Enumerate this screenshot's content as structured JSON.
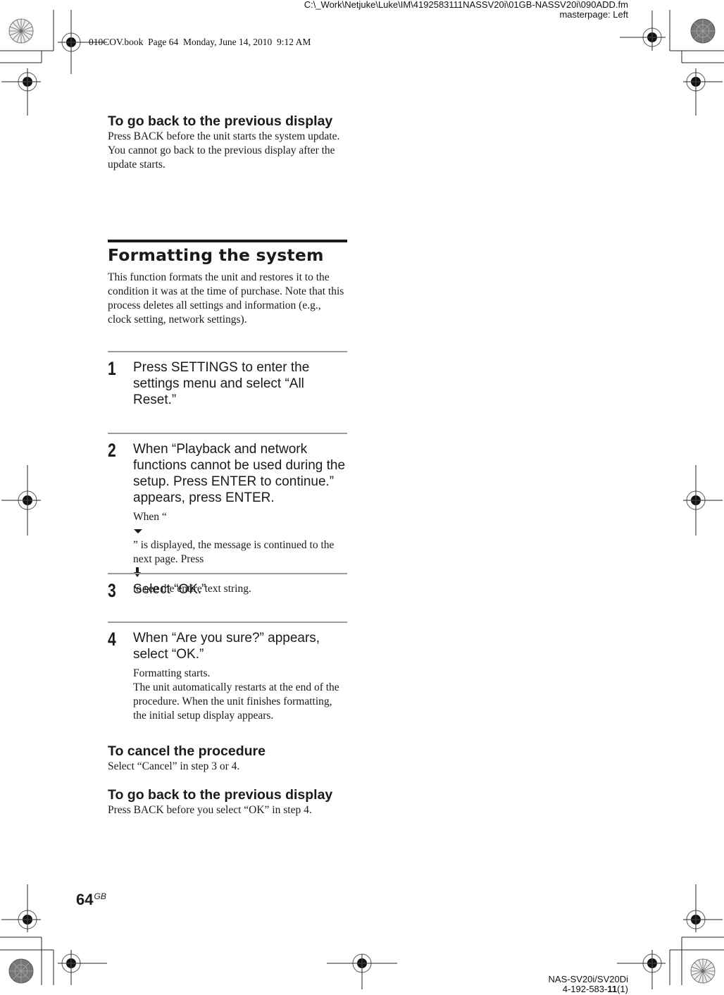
{
  "header": {
    "file_path": "C:\\_Work\\Netjuke\\Luke\\IM\\4192583111NASSV20i\\01GB-NASSV20i\\090ADD.fm",
    "masterpage": "masterpage: Left",
    "book_line": "010COV.book  Page 64  Monday, June 14, 2010  9:12 AM"
  },
  "intro": {
    "heading": "To go back to the previous display",
    "lines": [
      "Press BACK before the unit starts the system update.",
      "You cannot go back to the previous display after the update starts."
    ]
  },
  "section": {
    "title": "Formatting the system",
    "description": "This function formats the unit and restores it to the condition it was at the time of purchase. Note that this process deletes all settings and information (e.g., clock setting, network settings).",
    "steps": [
      {
        "number": "1",
        "text": "Press SETTINGS to enter the settings menu and select “All Reset.”"
      },
      {
        "number": "2",
        "text": "When “Playback and network functions cannot be used during the setup. Press ENTER to continue.” appears, press ENTER.",
        "note": {
          "part1": "When “",
          "icon1": "continue-triangle-icon",
          "part2": "” is displayed, the message is continued to the next page. Press ",
          "icon2": "down-arrow-icon",
          "part3": " to see the entire text string."
        }
      },
      {
        "number": "3",
        "text": "Select “OK.”"
      },
      {
        "number": "4",
        "text": "When “Are you sure?” appears, select “OK.”",
        "note_lines": [
          "Formatting starts.",
          "The unit automatically restarts at the end of the procedure. When the unit finishes formatting, the initial setup display appears."
        ]
      }
    ]
  },
  "cancel": {
    "heading": "To cancel the procedure",
    "text": "Select “Cancel” in step 3 or 4."
  },
  "back": {
    "heading": "To go back to the previous display",
    "text": "Press BACK before you select “OK” in step 4."
  },
  "footer": {
    "page_number": "64",
    "page_suffix": "GB",
    "model": "NAS-SV20i/SV20Di",
    "part_prefix": "4-192-583-",
    "part_bold": "11",
    "part_suffix": "(1)"
  }
}
